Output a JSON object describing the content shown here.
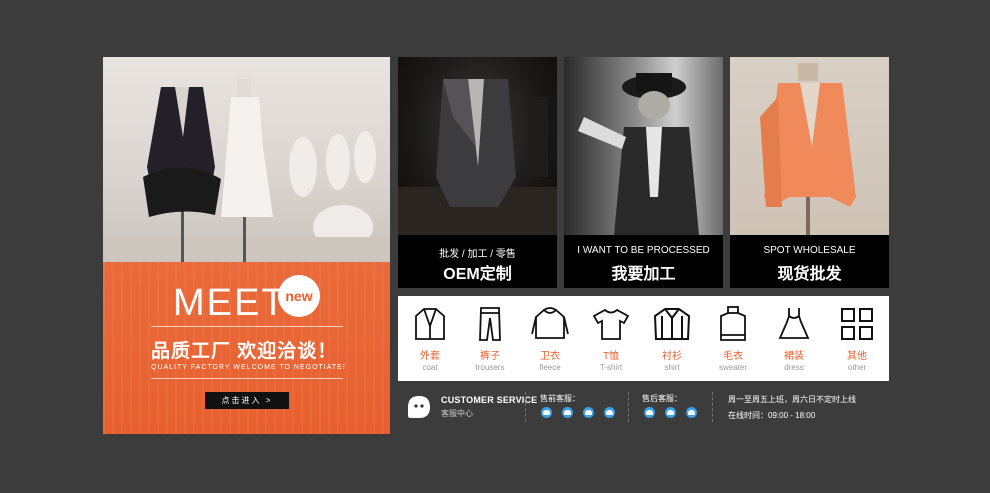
{
  "hero": {
    "meet": "MEET",
    "new_badge": "new",
    "slogan": "品质工厂 欢迎洽谈！",
    "slogan_en": "QUALITY FACTORY WELCOME TO NEGOTIATE!",
    "enter_label": "点击进入 >"
  },
  "cards": [
    {
      "sub": "批发 / 加工 / 零售",
      "title": "OEM定制"
    },
    {
      "sub": "I WANT TO BE PROCESSED",
      "title": "我要加工"
    },
    {
      "sub": "SPOT WHOLESALE",
      "title": "现货批发"
    }
  ],
  "categories": [
    {
      "zh": "外套",
      "en": "coat",
      "icon": "coat-icon"
    },
    {
      "zh": "裤子",
      "en": "trousers",
      "icon": "trousers-icon"
    },
    {
      "zh": "卫衣",
      "en": "fleece",
      "icon": "fleece-icon"
    },
    {
      "zh": "T恤",
      "en": "T-shirt",
      "icon": "tshirt-icon"
    },
    {
      "zh": "衬衫",
      "en": "shirt",
      "icon": "shirt-icon"
    },
    {
      "zh": "毛衣",
      "en": "sweater",
      "icon": "sweater-icon"
    },
    {
      "zh": "裙装",
      "en": "dress",
      "icon": "dress-icon"
    },
    {
      "zh": "其他",
      "en": "other",
      "icon": "grid-icon"
    }
  ],
  "service": {
    "title": "CUSTOMER SERVICE",
    "subtitle": "客服中心",
    "presale_label": "售前客服：",
    "aftersale_label": "售后客服：",
    "hours_line1": "周一至周五上班，周六日不定时上线",
    "hours_line2": "在线时间：09:00 - 18:00"
  },
  "colors": {
    "accent": "#e8602f",
    "background": "#3c3c3c",
    "qq": "#3aa0e6"
  }
}
